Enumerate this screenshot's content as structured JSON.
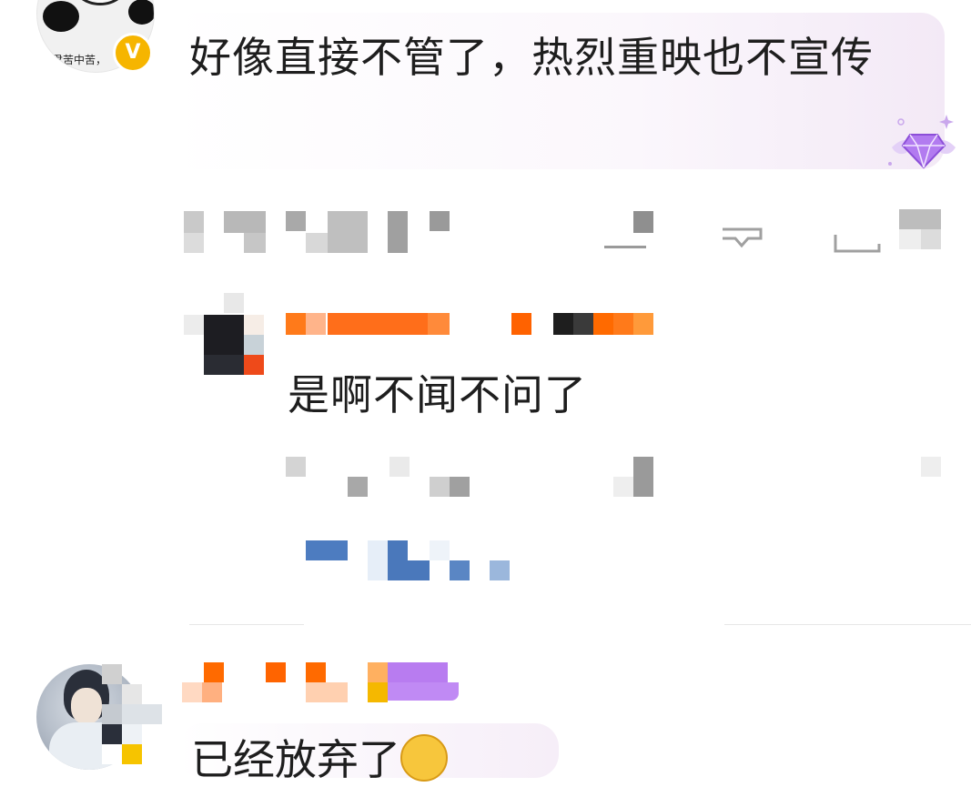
{
  "comment": {
    "avatar_caption": "君苦中苦，",
    "avatar_badge": "V",
    "text": "好像直接不管了，热烈重映也不宣传",
    "badge_icon": "diamond-icon"
  },
  "actions": {
    "icons": [
      "share-icon",
      "comment-icon",
      "like-icon"
    ]
  },
  "reply": {
    "text": "是啊不闻不问了"
  },
  "next_comment": {
    "text": "已经放弃了",
    "emoji_icon": "flushed-face-icon"
  },
  "colors": {
    "accent_orange": "#ff6a00",
    "badge_gold": "#f6b500",
    "link_blue": "#4a7ab8",
    "gem_purple": "#a86ee8"
  }
}
